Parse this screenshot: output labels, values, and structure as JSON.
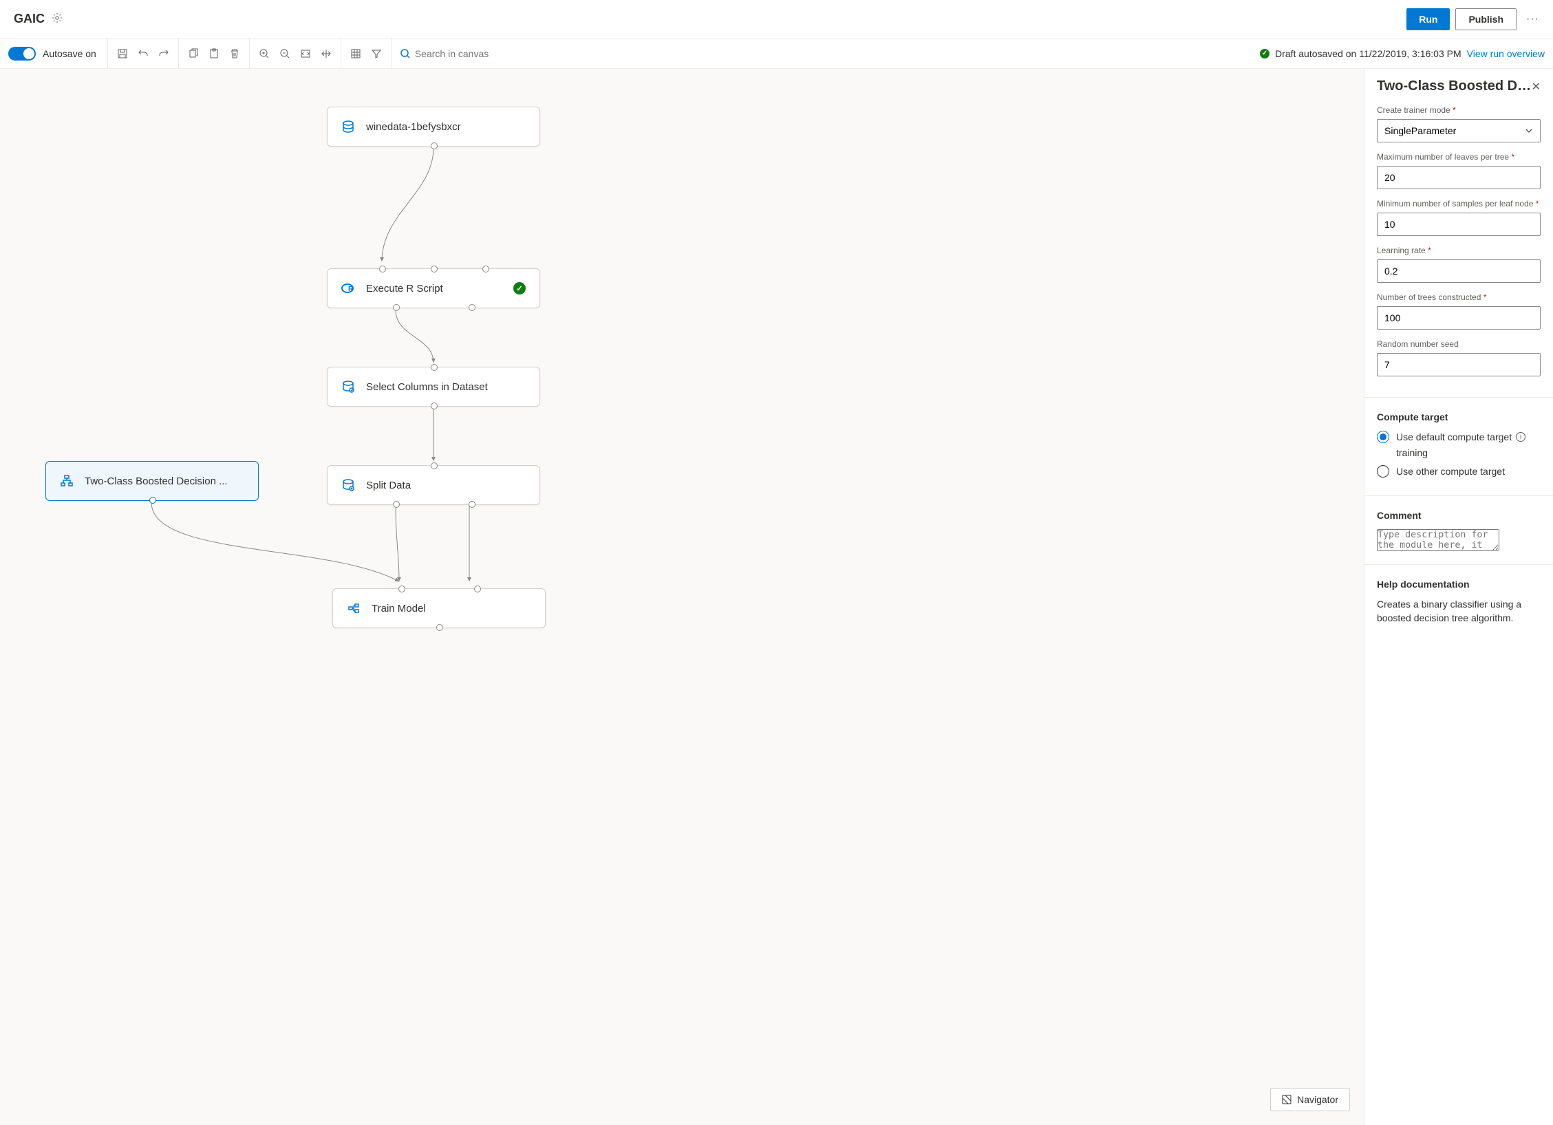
{
  "header": {
    "title": "GAIC",
    "run": "Run",
    "publish": "Publish"
  },
  "toolbar": {
    "autosave": "Autosave on",
    "search_placeholder": "Search in canvas",
    "status": "Draft autosaved on 11/22/2019, 3:16:03 PM",
    "view_run": "View run overview"
  },
  "nodes": {
    "n1": "winedata-1befysbxcr",
    "n2": "Execute R Script",
    "n3": "Select Columns in Dataset",
    "n4": "Split Data",
    "n5": "Two-Class Boosted Decision ...",
    "n6": "Train Model"
  },
  "navigator": "Navigator",
  "panel": {
    "title": "Two-Class Boosted Decisi...",
    "trainer_mode_label": "Create trainer mode",
    "trainer_mode_value": "SingleParameter",
    "max_leaves_label": "Maximum number of leaves per tree",
    "max_leaves_value": "20",
    "min_samples_label": "Minimum number of samples per leaf node",
    "min_samples_value": "10",
    "learning_rate_label": "Learning rate",
    "learning_rate_value": "0.2",
    "num_trees_label": "Number of trees constructed",
    "num_trees_value": "100",
    "seed_label": "Random number seed",
    "seed_value": "7",
    "compute_title": "Compute target",
    "compute_default": "Use default compute target",
    "compute_default_sub": "training",
    "compute_other": "Use other compute target",
    "comment_title": "Comment",
    "comment_placeholder": "Type description for the module here, it will display on the graph.",
    "help_title": "Help documentation",
    "help_text": "Creates a binary classifier using a boosted decision tree algorithm."
  }
}
